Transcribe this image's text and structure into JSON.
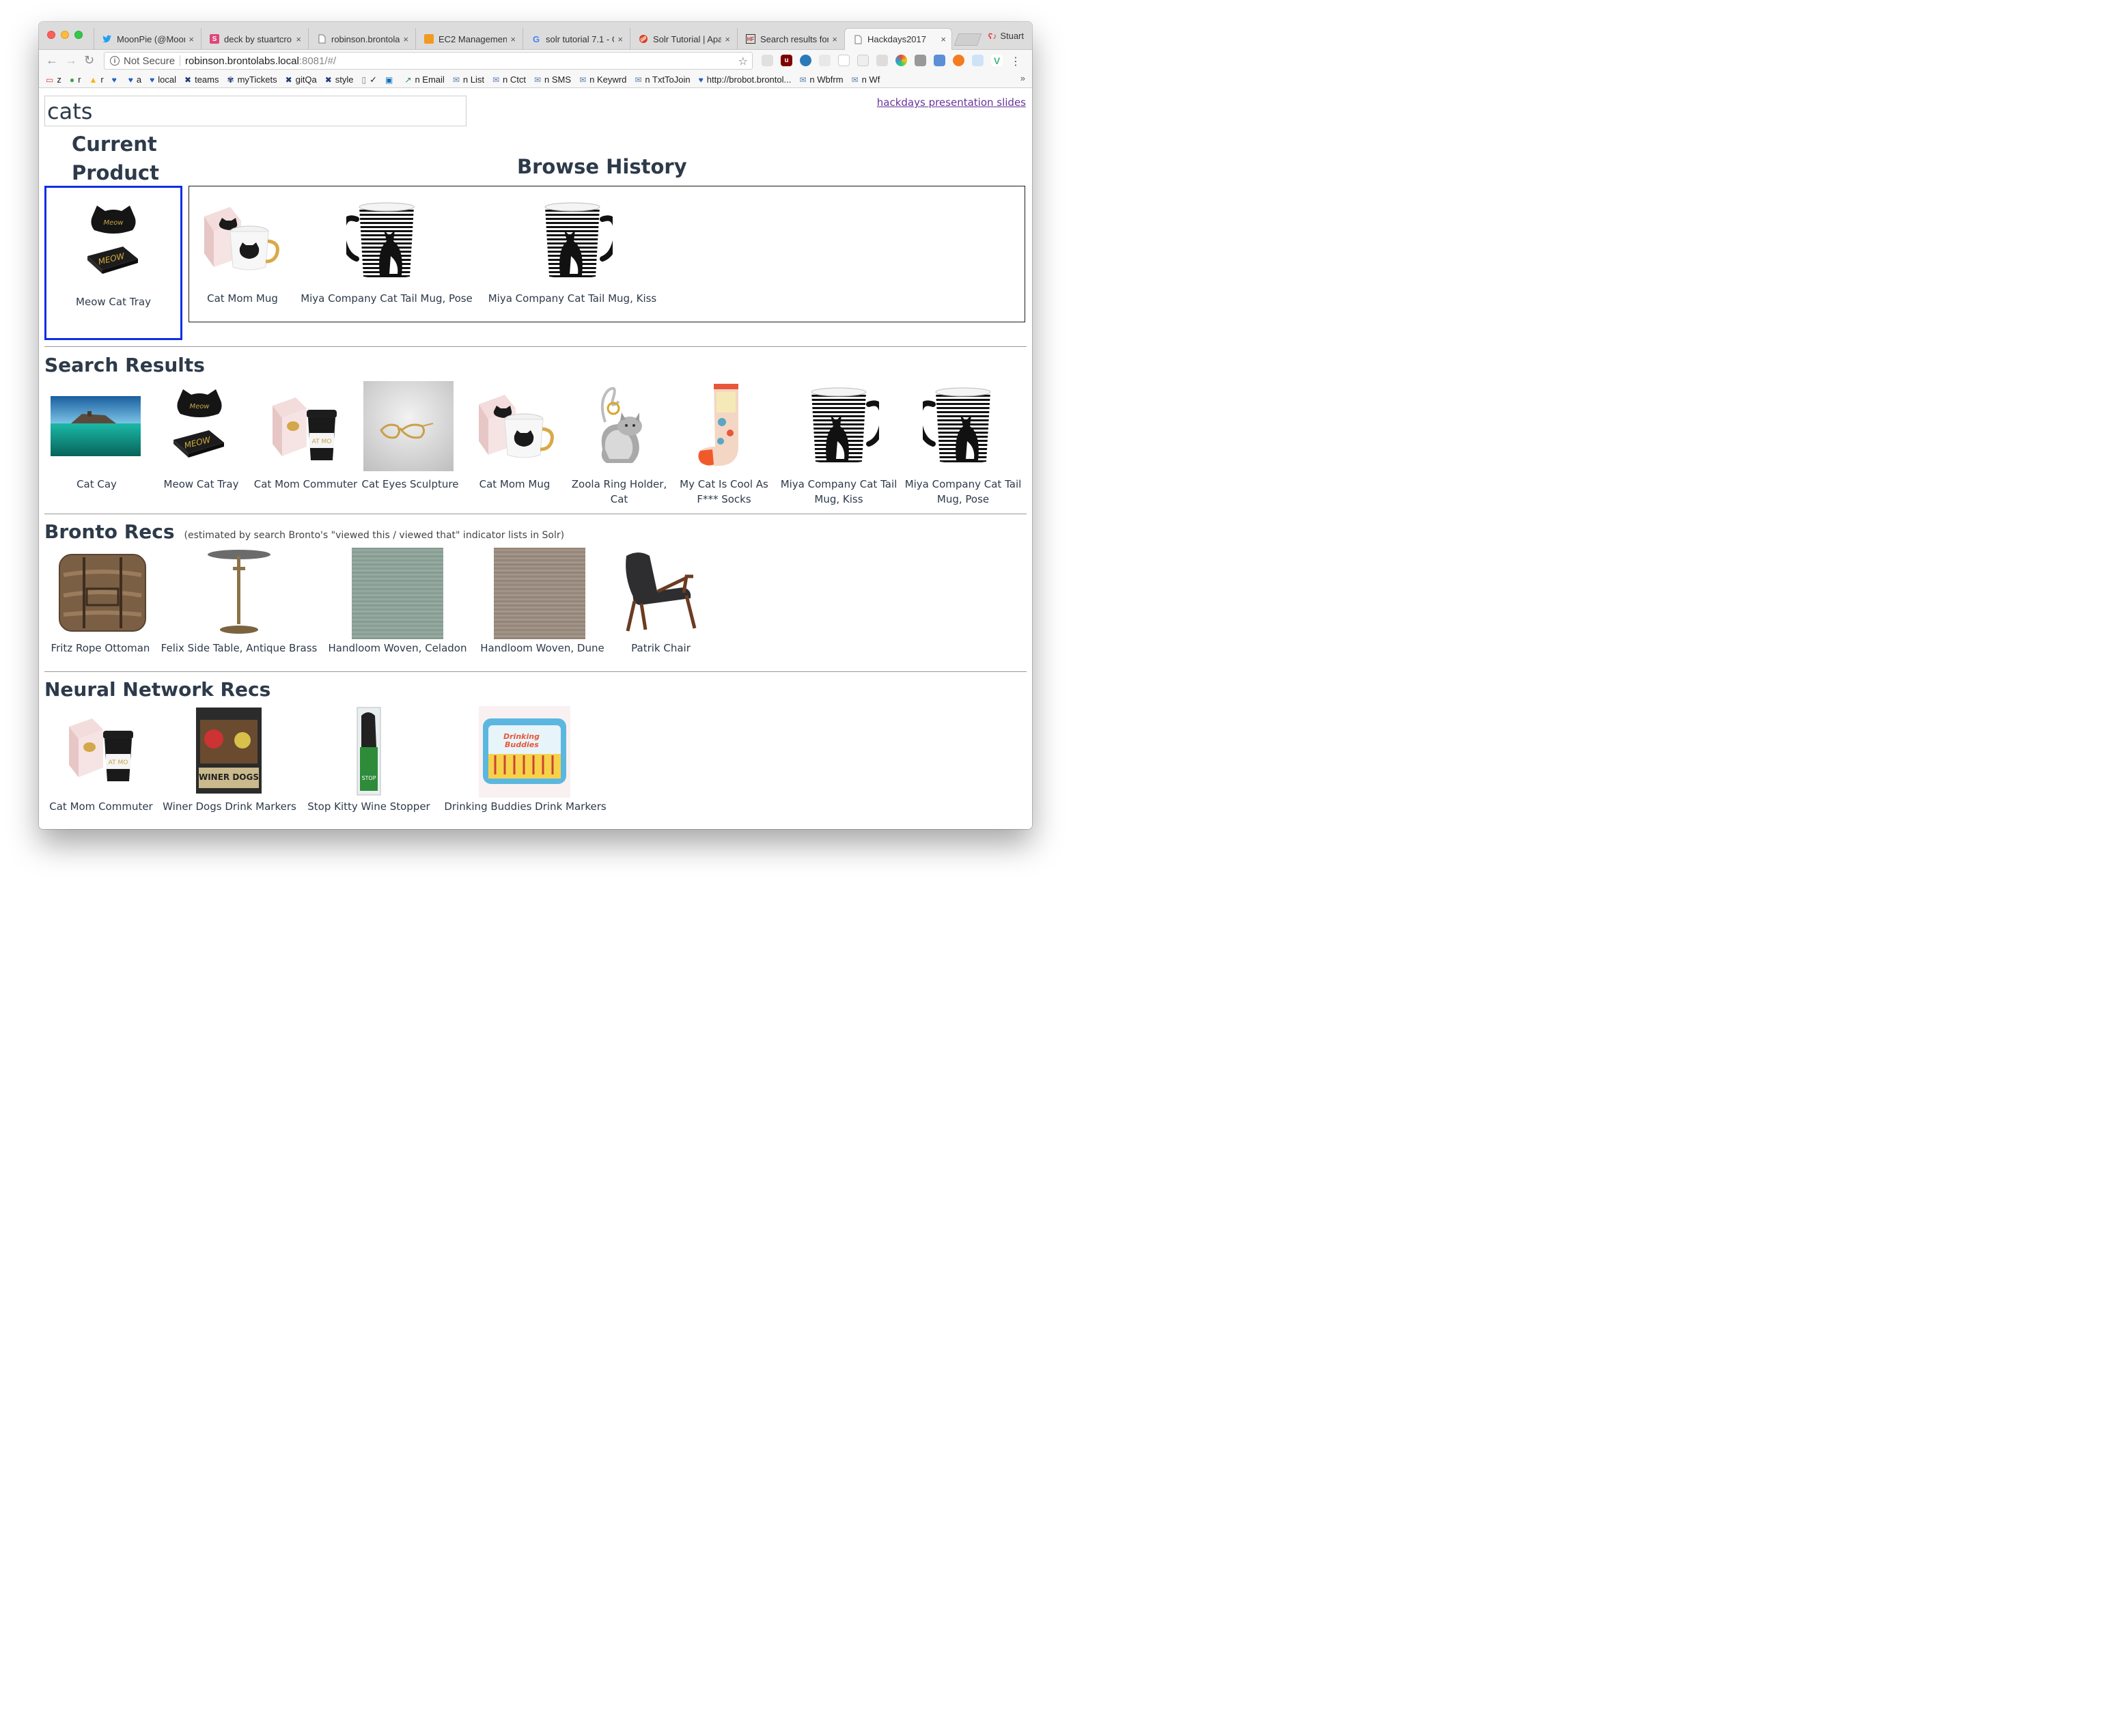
{
  "browser": {
    "tabs": [
      {
        "label": "MoonPie (@Moon",
        "icon": "twitter-icon"
      },
      {
        "label": "deck by stuartcro",
        "icon": "slides-s-icon"
      },
      {
        "label": "robinson.brontola",
        "icon": "page-icon"
      },
      {
        "label": "EC2 Management",
        "icon": "aws-icon"
      },
      {
        "label": "solr tutorial 7.1 - G",
        "icon": "google-icon"
      },
      {
        "label": "Solr Tutorial | Apa",
        "icon": "solr-icon"
      },
      {
        "label": "Search results for",
        "icon": "hf-icon"
      },
      {
        "label": "Hackdays2017",
        "icon": "page-icon",
        "active": true
      }
    ],
    "profile_name": "Stuart",
    "not_secure_label": "Not Secure",
    "url_host": "robinson.brontolabs.local",
    "url_path": ":8081/#/",
    "bookmarks": [
      {
        "label": "z",
        "icon": "bookmark-icon"
      },
      {
        "label": "r",
        "icon": "leaf-icon"
      },
      {
        "label": "r",
        "icon": "drive-icon"
      },
      {
        "label": "",
        "icon": "heart-icon"
      },
      {
        "label": "a",
        "icon": "heart-icon"
      },
      {
        "label": "local",
        "icon": "heart-icon"
      },
      {
        "label": "teams",
        "icon": "tool-icon"
      },
      {
        "label": "myTickets",
        "icon": "bug-icon"
      },
      {
        "label": "gitQa",
        "icon": "tool-icon"
      },
      {
        "label": "style",
        "icon": "tool-icon"
      },
      {
        "label": "✓",
        "icon": "page-icon"
      },
      {
        "label": "",
        "icon": "outlook-icon"
      },
      {
        "label": "n Email",
        "icon": "graph-icon"
      },
      {
        "label": "n List",
        "icon": "mail-icon"
      },
      {
        "label": "n Ctct",
        "icon": "mail-icon"
      },
      {
        "label": "n SMS",
        "icon": "mail-icon"
      },
      {
        "label": "n Keywrd",
        "icon": "mail-icon"
      },
      {
        "label": "n TxtToJoin",
        "icon": "mail-icon"
      },
      {
        "label": "http://brobot.brontol...",
        "icon": "heart-icon"
      },
      {
        "label": "n Wbfrm",
        "icon": "mail-icon"
      },
      {
        "label": "n Wf",
        "icon": "mail-icon"
      }
    ],
    "bookmarks_more": "»"
  },
  "page": {
    "search_value": "cats",
    "slides_link": "hackdays presentation slides",
    "current_product_heading": "Current Product",
    "browse_history_heading": "Browse History",
    "current_product": {
      "name": "Meow Cat Tray"
    },
    "browse_history": [
      {
        "name": "Cat Mom Mug"
      },
      {
        "name": "Miya Company Cat Tail Mug, Pose"
      },
      {
        "name": "Miya Company Cat Tail Mug, Kiss"
      }
    ],
    "search_results_heading": "Search Results",
    "search_results": [
      {
        "name": "Cat Cay"
      },
      {
        "name": "Meow Cat Tray"
      },
      {
        "name": "Cat Mom Commuter"
      },
      {
        "name": "Cat Eyes Sculpture"
      },
      {
        "name": "Cat Mom Mug"
      },
      {
        "name": "Zoola Ring Holder, Cat"
      },
      {
        "name": "My Cat Is Cool As F*** Socks"
      },
      {
        "name": "Miya Company Cat Tail Mug, Kiss"
      },
      {
        "name": "Miya Company Cat Tail Mug, Pose"
      }
    ],
    "bronto_heading": "Bronto Recs",
    "bronto_note": "(estimated by search Bronto's \"viewed this / viewed that\" indicator lists in Solr)",
    "bronto_recs": [
      {
        "name": "Fritz Rope Ottoman"
      },
      {
        "name": "Felix Side Table, Antique Brass"
      },
      {
        "name": "Handloom Woven, Celadon"
      },
      {
        "name": "Handloom Woven, Dune"
      },
      {
        "name": "Patrik Chair"
      }
    ],
    "neural_heading": "Neural Network Recs",
    "neural_recs": [
      {
        "name": "Cat Mom Commuter"
      },
      {
        "name": "Winer Dogs Drink Markers"
      },
      {
        "name": "Stop Kitty Wine Stopper"
      },
      {
        "name": "Drinking Buddies Drink Markers"
      }
    ],
    "colors": {
      "heading": "#2d3a4a",
      "current_border": "#0c2fe0",
      "link": "#663399"
    }
  }
}
